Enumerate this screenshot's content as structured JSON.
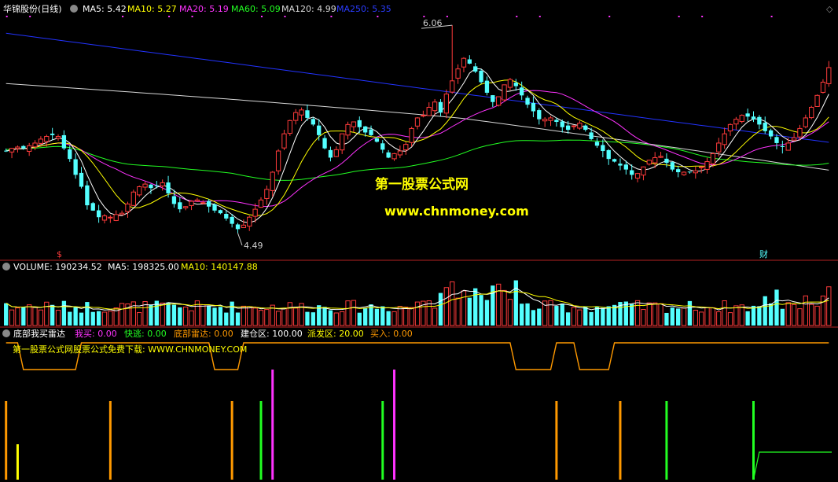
{
  "colors": {
    "bg": "#000000",
    "up": "#ff3b3b",
    "down": "#54ffff",
    "ma5": "#ffffff",
    "ma10": "#ffff00",
    "ma20": "#ff33ff",
    "ma60": "#22ff22",
    "ma120": "#d8d8d8",
    "ma250": "#2233ff",
    "separator": "#b22222",
    "orange": "#ff9900",
    "green": "#22ff22",
    "magenta": "#ff33ff",
    "yellow": "#ffff00",
    "watermark": "#ffff00"
  },
  "header_main": {
    "stock": "华锦股份(日线)",
    "ma5": "MA5: 5.42",
    "ma10": "MA10: 5.27",
    "ma20": "MA20: 5.19",
    "ma60": "MA60: 5.09",
    "ma120": "MA120: 4.99",
    "ma250": "MA250: 5.35"
  },
  "header_volume": {
    "label": "VOLUME: 190234.52",
    "ma5": "MA5: 198325.00",
    "ma10": "MA10: 140147.88"
  },
  "header_indicator": {
    "name": "底部我买雷达",
    "buy": "我买: 0.00",
    "escape": "快逃: 0.00",
    "radar": "底部雷达: 0.00",
    "build": "建仓区: 100.00",
    "dispatch": "派发区: 20.00",
    "buyin": "买入: 0.00"
  },
  "indicator_text": "第一股票公式网股票公式免费下载: WWW.CHNMONEY.COM",
  "watermark": {
    "line1": "第一股票公式网",
    "line2": "www.chnmoney.com"
  },
  "price_labels": {
    "high": "6.06",
    "low": "4.49"
  },
  "markers": {
    "dollar": "$",
    "fin": "财"
  },
  "chart_data": [
    {
      "type": "candlestick",
      "title": "华锦股份(日线)",
      "price_range": [
        4.35,
        6.12
      ],
      "high_label": 6.06,
      "low_label": 4.49,
      "ohlc_close_approx": [
        5.11,
        5.13,
        5.14,
        5.13,
        5.15,
        5.17,
        5.2,
        5.22,
        5.23,
        5.22,
        5.13,
        5.05,
        4.93,
        4.84,
        4.7,
        4.66,
        4.61,
        4.62,
        4.61,
        4.63,
        4.64,
        4.71,
        4.8,
        4.84,
        4.86,
        4.83,
        4.85,
        4.87,
        4.79,
        4.71,
        4.67,
        4.69,
        4.73,
        4.74,
        4.72,
        4.69,
        4.66,
        4.64,
        4.6,
        4.56,
        4.52,
        4.55,
        4.61,
        4.67,
        4.74,
        4.82,
        4.95,
        5.11,
        5.24,
        5.34,
        5.4,
        5.42,
        5.36,
        5.31,
        5.23,
        5.13,
        5.06,
        5.12,
        5.24,
        5.31,
        5.33,
        5.29,
        5.25,
        5.23,
        5.18,
        5.12,
        5.06,
        5.09,
        5.11,
        5.16,
        5.28,
        5.36,
        5.38,
        5.44,
        5.48,
        5.4,
        5.54,
        5.64,
        5.73,
        5.81,
        5.77,
        5.71,
        5.63,
        5.55,
        5.48,
        5.52,
        5.61,
        5.65,
        5.6,
        5.53,
        5.46,
        5.41,
        5.35,
        5.35,
        5.36,
        5.33,
        5.29,
        5.27,
        5.3,
        5.32,
        5.27,
        5.2,
        5.15,
        5.11,
        5.05,
        5.03,
        5,
        4.97,
        4.93,
        4.94,
        4.99,
        5.04,
        5.06,
        5.07,
        5.02,
        4.97,
        4.95,
        4.95,
        4.95,
        4.96,
        4.99,
        5.03,
        5.09,
        5.17,
        5.24,
        5.31,
        5.35,
        5.38,
        5.37,
        5.35,
        5.31,
        5.26,
        5.22,
        5.17,
        5.14,
        5.17,
        5.21,
        5.28,
        5.36,
        5.44,
        5.53,
        5.63,
        5.74
      ],
      "volume_header": "VOLUME: 190234.52"
    },
    {
      "type": "bar",
      "name": "底部我买雷达",
      "signals": [
        {
          "bar": 0,
          "color": "orange",
          "value": 100
        },
        {
          "bar": 2,
          "color": "yellow",
          "value": 45
        },
        {
          "bar": 18,
          "color": "orange",
          "value": 100
        },
        {
          "bar": 39,
          "color": "orange",
          "value": 100
        },
        {
          "bar": 44,
          "color": "green",
          "value": 100
        },
        {
          "bar": 46,
          "color": "magenta",
          "value": 140
        },
        {
          "bar": 65,
          "color": "green",
          "value": 100
        },
        {
          "bar": 67,
          "color": "magenta",
          "value": 140
        },
        {
          "bar": 95,
          "color": "orange",
          "value": 100
        },
        {
          "bar": 106,
          "color": "orange",
          "value": 100
        },
        {
          "bar": 114,
          "color": "green",
          "value": 100
        },
        {
          "bar": 129,
          "color": "green",
          "value": 100
        }
      ]
    }
  ]
}
